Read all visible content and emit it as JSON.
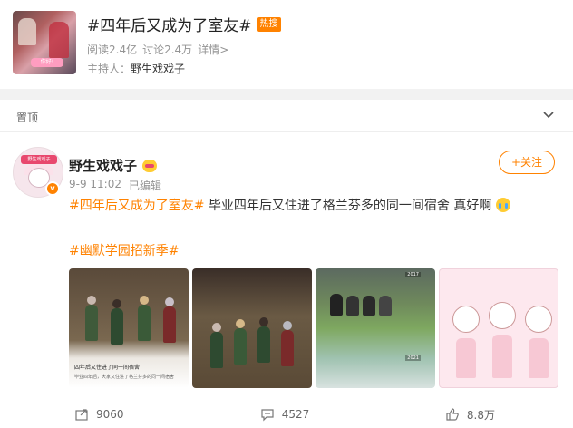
{
  "topic": {
    "title": "#四年后又成为了室友#",
    "badge": "热搜",
    "reads": "阅读2.4亿",
    "discussions": "讨论2.4万",
    "details_link": "详情>",
    "host_label": "主持人：",
    "host_name": "野生戏戏子",
    "thumb_caption": "你好!"
  },
  "pinned": {
    "label": "置顶",
    "toggle_icon": "chevron-down-icon"
  },
  "post": {
    "author": "野生戏戏子",
    "avatar_caption": "野生戏戏子",
    "time": "9-9 11:02",
    "edited": "已编辑",
    "follow_label": "+关注",
    "tag1": "#四年后又成为了室友#",
    "text": " 毕业四年后又住进了格兰芬多的同一间宿舍 真好啊",
    "tag2": "#幽默学园招新季#",
    "images": [
      {
        "caption": "四年后又住进了同一间宿舍",
        "subcaption": "毕业四年后，大家又住进了格兰芬多的同一间宿舍"
      },
      {},
      {
        "year_top": "2017",
        "year_bottom": "2021"
      },
      {}
    ]
  },
  "actions": {
    "share_count": "9060",
    "comment_count": "4527",
    "like_count": "8.8万"
  },
  "colors": {
    "accent": "#ff8200",
    "text": "#333333",
    "muted": "#939393"
  }
}
